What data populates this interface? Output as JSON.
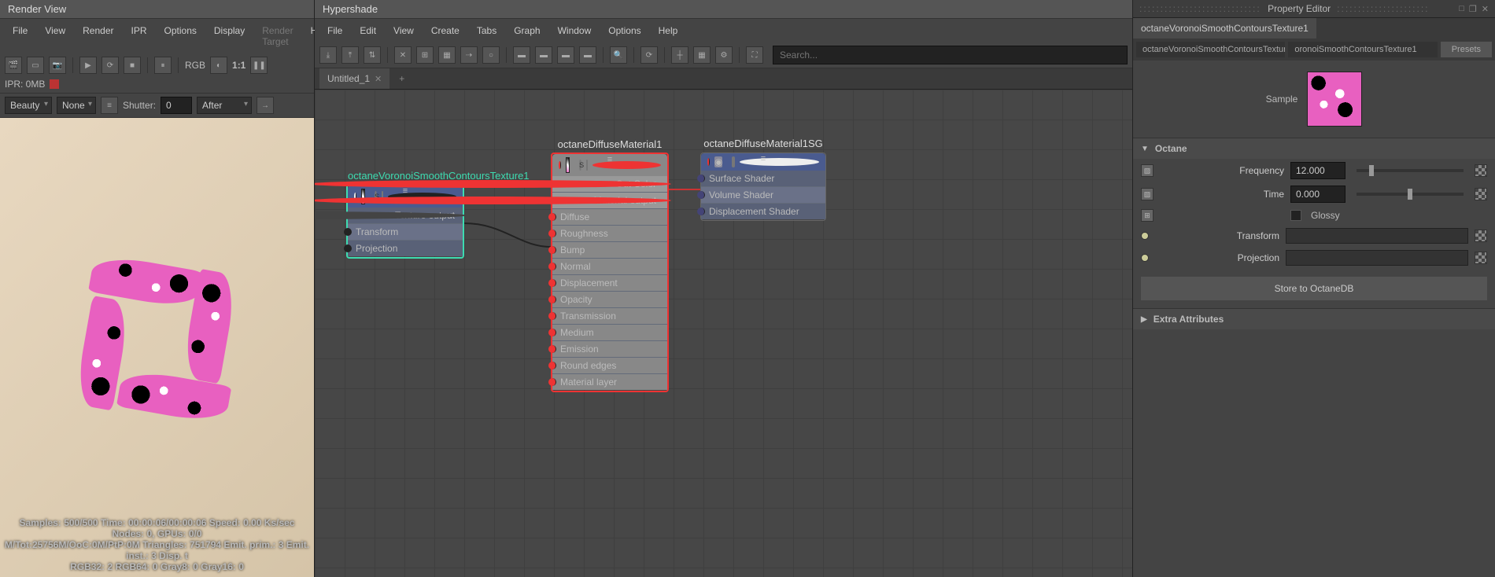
{
  "renderView": {
    "title": "Render View",
    "menus": [
      "File",
      "View",
      "Render",
      "IPR",
      "Options",
      "Display",
      "Render Target",
      "Help"
    ],
    "rgb": "RGB",
    "ratio": "1:1",
    "iprLabel": "IPR: 0MB",
    "beauty": "Beauty",
    "none": "None",
    "shutter": "Shutter:",
    "shutterVal": "0",
    "after": "After",
    "stats1": "Samples: 500/500 Time: 00:00:06/00:00:06 Speed: 0.00 Ks/sec",
    "stats2": "Nodes: 0, GPUs: 0/0",
    "stats3": "M/Tot:25756M/OoC:0M/PtP:0M Triangles: 751794 Emit. prim.: 3 Emit. inst.: 3 Disp. t",
    "stats4": "RGB32: 2 RGB64: 0 Gray8: 0 Gray16: 0"
  },
  "hypershade": {
    "title": "Hypershade",
    "menus": [
      "File",
      "Edit",
      "View",
      "Create",
      "Tabs",
      "Graph",
      "Window",
      "Options",
      "Help"
    ],
    "searchPlaceholder": "Search...",
    "tab": "Untitled_1",
    "node1": {
      "title": "octaneVoronoiSmoothContoursTexture1",
      "out": "Texture output",
      "in1": "Transform",
      "in2": "Projection"
    },
    "node2": {
      "title": "octaneDiffuseMaterial1",
      "out1": "Out Color",
      "out2": "Material output",
      "ins": [
        "Diffuse",
        "Roughness",
        "Bump",
        "Normal",
        "Displacement",
        "Opacity",
        "Transmission",
        "Medium",
        "Emission",
        "Round edges",
        "Material layer"
      ]
    },
    "node3": {
      "title": "octaneDiffuseMaterial1SG",
      "ins": [
        "Surface Shader",
        "Volume Shader",
        "Displacement Shader"
      ]
    }
  },
  "propEditor": {
    "title": "Property Editor",
    "tab": "octaneVoronoiSmoothContoursTexture1",
    "path1": "octaneVoronoiSmoothContoursTexture:",
    "path2": "oronoiSmoothContoursTexture1",
    "presets": "Presets",
    "sampleLabel": "Sample",
    "sections": {
      "octane": "Octane",
      "extra": "Extra Attributes"
    },
    "props": {
      "freqLabel": "Frequency",
      "freqVal": "12.000",
      "timeLabel": "Time",
      "timeVal": "0.000",
      "glossy": "Glossy",
      "transform": "Transform",
      "projection": "Projection"
    },
    "storeBtn": "Store to OctaneDB"
  },
  "chart_data": {
    "type": "node-graph",
    "nodes": [
      {
        "id": "tex",
        "label": "octaneVoronoiSmoothContoursTexture1",
        "outputs": [
          "Texture output"
        ],
        "inputs": [
          "Transform",
          "Projection"
        ]
      },
      {
        "id": "mat",
        "label": "octaneDiffuseMaterial1",
        "outputs": [
          "Out Color",
          "Material output"
        ],
        "inputs": [
          "Diffuse",
          "Roughness",
          "Bump",
          "Normal",
          "Displacement",
          "Opacity",
          "Transmission",
          "Medium",
          "Emission",
          "Round edges",
          "Material layer"
        ]
      },
      {
        "id": "sg",
        "label": "octaneDiffuseMaterial1SG",
        "outputs": [],
        "inputs": [
          "Surface Shader",
          "Volume Shader",
          "Displacement Shader"
        ]
      }
    ],
    "edges": [
      {
        "from": "tex.Texture output",
        "to": "mat.Diffuse"
      },
      {
        "from": "mat.Out Color",
        "to": "sg.Surface Shader"
      }
    ]
  }
}
